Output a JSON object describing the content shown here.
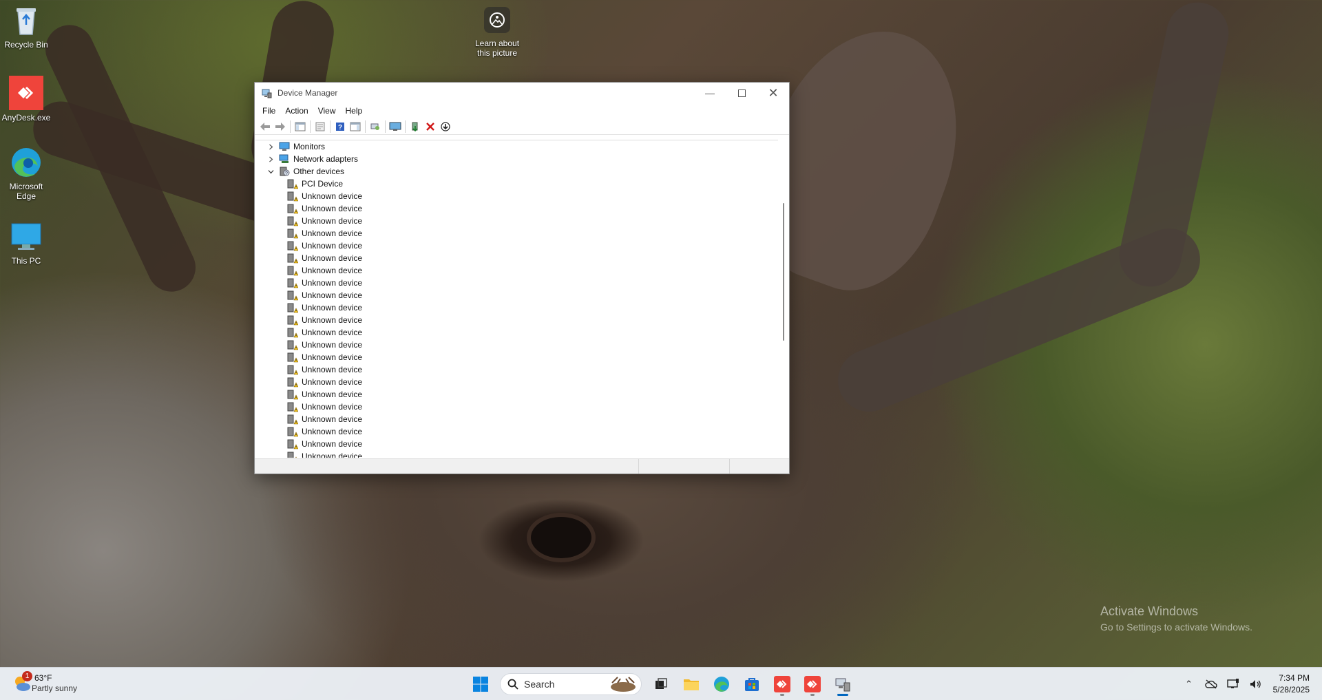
{
  "desktop": {
    "icons": [
      {
        "label": "Recycle Bin"
      },
      {
        "label": "AnyDesk.exe"
      },
      {
        "label": "Microsoft Edge"
      },
      {
        "label": "This PC"
      }
    ],
    "learn_line1": "Learn about",
    "learn_line2": "this picture"
  },
  "window": {
    "title": "Device Manager",
    "menu": [
      "File",
      "Action",
      "View",
      "Help"
    ],
    "tree": [
      {
        "label": "Monitors",
        "level": 1,
        "expander": "collapsed",
        "icon": "monitor-icon"
      },
      {
        "label": "Network adapters",
        "level": 1,
        "expander": "collapsed",
        "icon": "network-adapter-icon"
      },
      {
        "label": "Other devices",
        "level": 1,
        "expander": "expanded",
        "icon": "other-devices-icon"
      },
      {
        "label": "PCI Device",
        "level": 2,
        "icon": "warning-device-icon"
      },
      {
        "label": "Unknown device",
        "level": 2,
        "icon": "warning-device-icon"
      },
      {
        "label": "Unknown device",
        "level": 2,
        "icon": "warning-device-icon"
      },
      {
        "label": "Unknown device",
        "level": 2,
        "icon": "warning-device-icon"
      },
      {
        "label": "Unknown device",
        "level": 2,
        "icon": "warning-device-icon"
      },
      {
        "label": "Unknown device",
        "level": 2,
        "icon": "warning-device-icon"
      },
      {
        "label": "Unknown device",
        "level": 2,
        "icon": "warning-device-icon"
      },
      {
        "label": "Unknown device",
        "level": 2,
        "icon": "warning-device-icon"
      },
      {
        "label": "Unknown device",
        "level": 2,
        "icon": "warning-device-icon"
      },
      {
        "label": "Unknown device",
        "level": 2,
        "icon": "warning-device-icon"
      },
      {
        "label": "Unknown device",
        "level": 2,
        "icon": "warning-device-icon"
      },
      {
        "label": "Unknown device",
        "level": 2,
        "icon": "warning-device-icon"
      },
      {
        "label": "Unknown device",
        "level": 2,
        "icon": "warning-device-icon"
      },
      {
        "label": "Unknown device",
        "level": 2,
        "icon": "warning-device-icon"
      },
      {
        "label": "Unknown device",
        "level": 2,
        "icon": "warning-device-icon"
      },
      {
        "label": "Unknown device",
        "level": 2,
        "icon": "warning-device-icon"
      },
      {
        "label": "Unknown device",
        "level": 2,
        "icon": "warning-device-icon"
      },
      {
        "label": "Unknown device",
        "level": 2,
        "icon": "warning-device-icon"
      },
      {
        "label": "Unknown device",
        "level": 2,
        "icon": "warning-device-icon"
      },
      {
        "label": "Unknown device",
        "level": 2,
        "icon": "warning-device-icon"
      },
      {
        "label": "Unknown device",
        "level": 2,
        "icon": "warning-device-icon"
      },
      {
        "label": "Unknown device",
        "level": 2,
        "icon": "warning-device-icon"
      },
      {
        "label": "Unknown device",
        "level": 2,
        "icon": "warning-device-icon"
      },
      {
        "label": "Unknown device",
        "level": 2,
        "icon": "warning-device-icon"
      }
    ]
  },
  "watermark": {
    "line1": "Activate Windows",
    "line2": "Go to Settings to activate Windows."
  },
  "taskbar": {
    "weather_badge": "1",
    "weather_temp": "63°F",
    "weather_condition": "Partly sunny",
    "search_label": "Search",
    "time": "7:34 PM",
    "date": "5/28/2025"
  },
  "colors": {
    "accent": "#0067c0",
    "warning": "#f2c21b",
    "anydesk": "#ef443b"
  }
}
